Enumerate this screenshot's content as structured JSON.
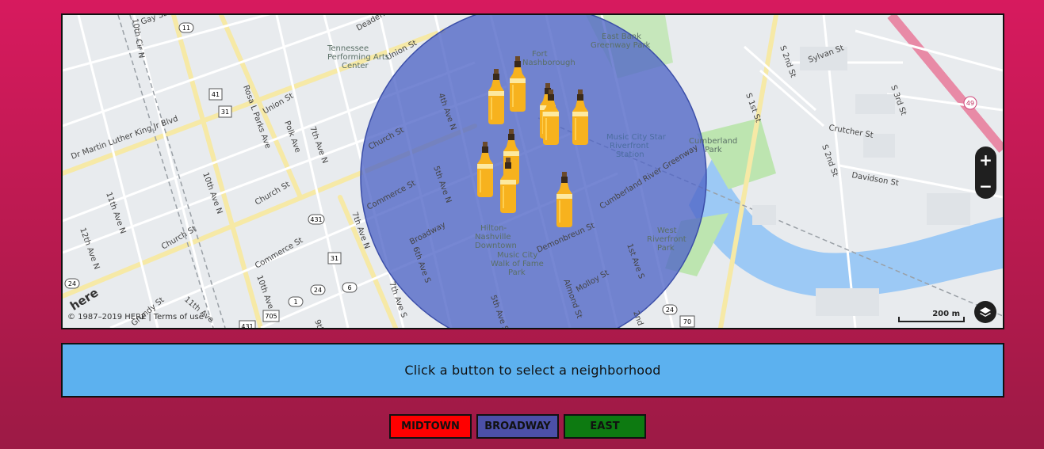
{
  "map": {
    "zoom_in": "+",
    "zoom_out": "−",
    "scale_label": "200 m",
    "copyright": "© 1987–2019 HERE",
    "terms": "Terms of use",
    "logo": "here",
    "layers_icon": "layers-icon",
    "radius_color": "#4f65c6",
    "marker_icon": "beer-bottle-icon",
    "street_labels": [
      "Dr Martin Luther King Jr Blvd",
      "Union St",
      "Church St",
      "Commerce St",
      "Broadway",
      "Rosa L Parks Ave",
      "Polk Ave",
      "7th Ave N",
      "10th Ave N",
      "11th Ave N",
      "12th Ave N",
      "10th Cir N",
      "Gay St",
      "Deaderick St",
      "4th Ave N",
      "5th Ave N",
      "6th Ave N",
      "Church St",
      "Demonbreun St",
      "Molloy St",
      "1st Ave S",
      "Almond St",
      "5th Ave S",
      "2nd Ave S",
      "S 2nd St",
      "S 1st St",
      "Sylvan St",
      "S 3rd St",
      "Crutcher St",
      "S 2nd St",
      "Davidson St",
      "Cumberland River Greenway",
      "11th Ave",
      "Grundy St",
      "Commerce St",
      "9th Ave",
      "10th Ave S",
      "7th Ave S",
      "6th Ave S",
      "Music City Star Riverfront Station"
    ],
    "poi_labels": [
      "Tennessee Performing Arts Center",
      "Fort Nashborough",
      "East Bank Greenway Park",
      "Cumberland Park",
      "West Riverfront Park",
      "Hilton-Nashville Downtown",
      "Music City Walk of Fame Park"
    ],
    "route_shields": [
      "11",
      "41",
      "31",
      "431",
      "31",
      "24",
      "1",
      "24",
      "6",
      "705",
      "431",
      "70",
      "24",
      "49"
    ]
  },
  "info": {
    "text": "Click a button to select a neighborhood"
  },
  "buttons": [
    {
      "label": "MIDTOWN",
      "color": "#ff0000"
    },
    {
      "label": "BROADWAY",
      "color": "#4c50a8"
    },
    {
      "label": "EAST",
      "color": "#0d7a11"
    }
  ]
}
